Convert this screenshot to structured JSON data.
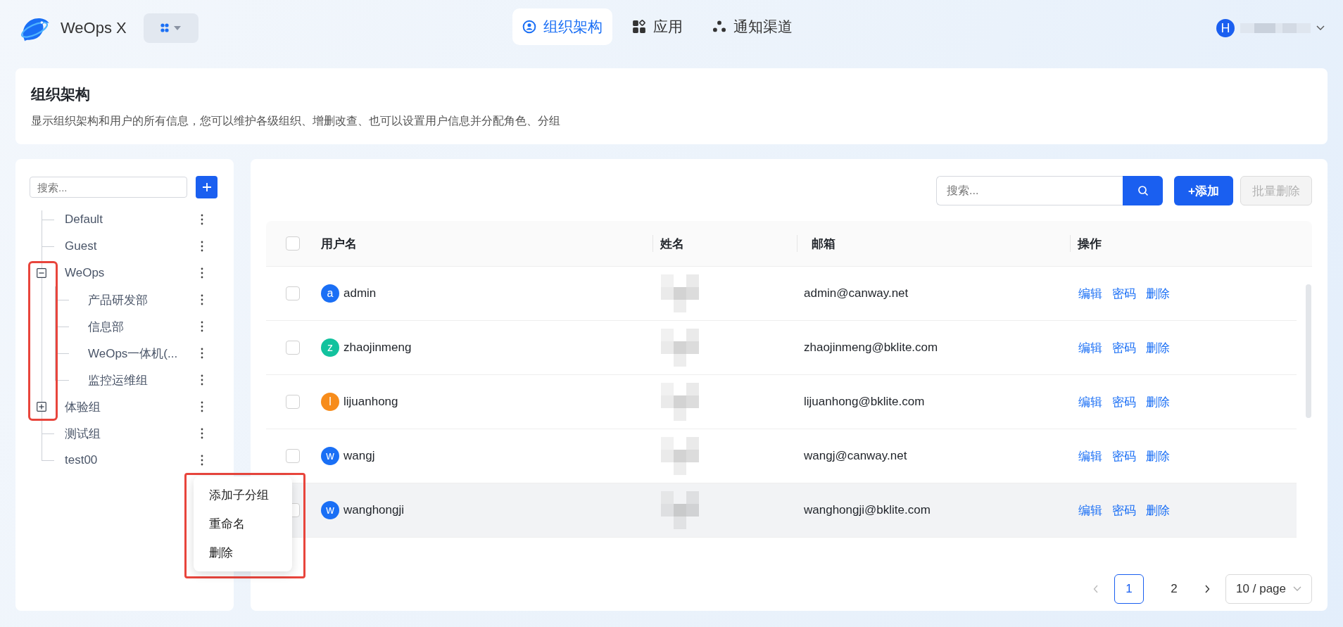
{
  "header": {
    "app_name": "WeOps X",
    "nav": [
      {
        "label": "组织架构",
        "selected": true,
        "kind": "org"
      },
      {
        "label": "应用",
        "selected": false,
        "kind": "apps"
      },
      {
        "label": "通知渠道",
        "selected": false,
        "kind": "channels"
      }
    ],
    "user_initial": "H"
  },
  "page": {
    "title": "组织架构",
    "description": "显示组织架构和用户的所有信息，您可以维护各级组织、增删改查、也可以设置用户信息并分配角色、分组"
  },
  "tree": {
    "search_placeholder": "搜索...",
    "items": [
      {
        "label": "Default",
        "kind": "leaf"
      },
      {
        "label": "Guest",
        "kind": "leaf"
      },
      {
        "label": "WeOps",
        "kind": "group",
        "expanded": true,
        "children": [
          {
            "label": "产品研发部"
          },
          {
            "label": "信息部"
          },
          {
            "label": "WeOps一体机(..."
          },
          {
            "label": "监控运维组"
          }
        ]
      },
      {
        "label": "体验组",
        "kind": "group",
        "expanded": false
      },
      {
        "label": "测试组",
        "kind": "leaf"
      },
      {
        "label": "test00",
        "kind": "leaf"
      }
    ]
  },
  "context_menu": {
    "items": [
      "添加子分组",
      "重命名",
      "删除"
    ]
  },
  "toolbar": {
    "search_placeholder": "搜索...",
    "add_label": "+添加",
    "batch_delete": {
      "label": "批量删除",
      "disabled": true
    }
  },
  "table": {
    "columns": [
      "用户名",
      "姓名",
      "邮箱",
      "操作"
    ],
    "header_checked": false,
    "rows": [
      {
        "avatar": "a",
        "color": "#1a6ff5",
        "username": "admin",
        "email": "admin@canway.net",
        "actions": [
          "编辑",
          "密码",
          "删除"
        ],
        "checked": false,
        "highlighted": false
      },
      {
        "avatar": "z",
        "color": "#12c29e",
        "username": "zhaojinmeng",
        "email": "zhaojinmeng@bklite.com",
        "actions": [
          "编辑",
          "密码",
          "删除"
        ],
        "checked": false,
        "highlighted": false
      },
      {
        "avatar": "l",
        "color": "#f78c1b",
        "username": "lijuanhong",
        "email": "lijuanhong@bklite.com",
        "actions": [
          "编辑",
          "密码",
          "删除"
        ],
        "checked": false,
        "highlighted": false
      },
      {
        "avatar": "w",
        "color": "#1a6ff5",
        "username": "wangj",
        "email": "wangj@canway.net",
        "actions": [
          "编辑",
          "密码",
          "删除"
        ],
        "checked": false,
        "highlighted": false
      },
      {
        "avatar": "w",
        "color": "#1a6ff5",
        "username": "wanghongji",
        "email": "wanghongji@bklite.com",
        "actions": [
          "编辑",
          "密码",
          "删除"
        ],
        "checked": false,
        "highlighted": true
      }
    ]
  },
  "pagination": {
    "pages": [
      {
        "label": "1",
        "selected": true
      },
      {
        "label": "2",
        "selected": false
      }
    ],
    "page_size": "10 / page"
  }
}
